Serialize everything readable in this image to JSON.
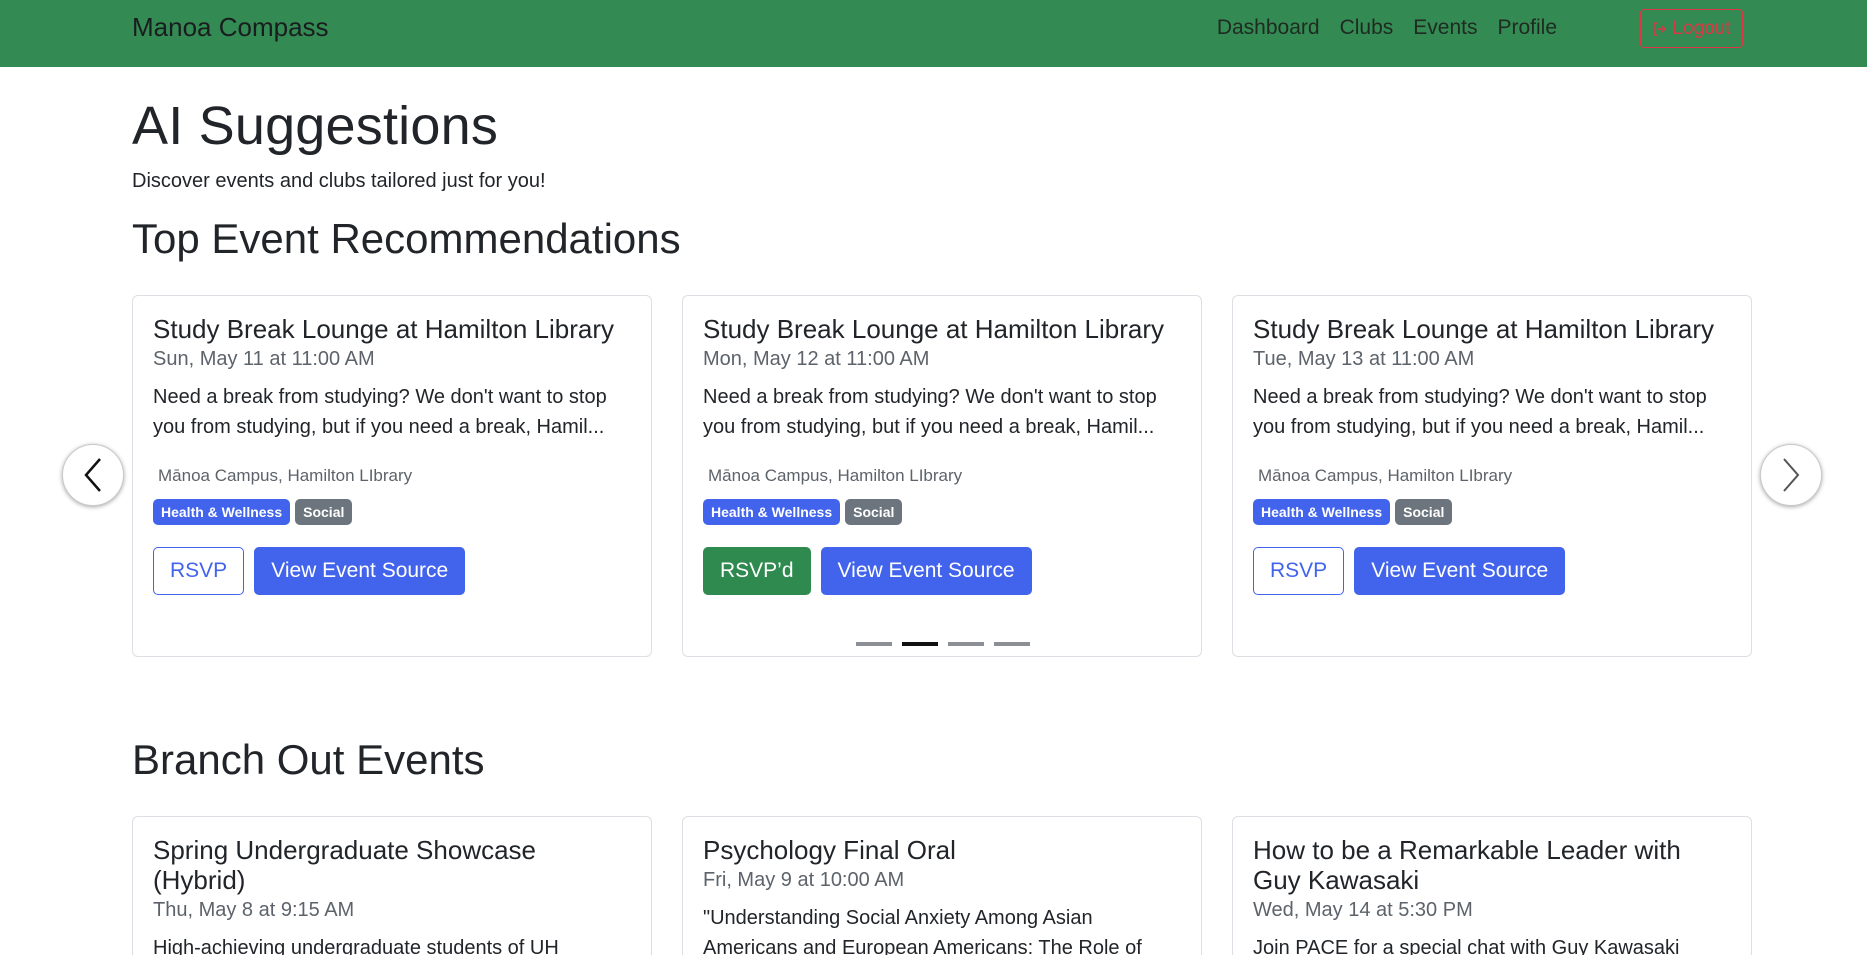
{
  "nav": {
    "brand": "Manoa Compass",
    "links": [
      "Dashboard",
      "Clubs",
      "Events",
      "Profile"
    ],
    "logout": "Logout"
  },
  "page": {
    "title": "AI Suggestions",
    "subtitle": "Discover events and clubs tailored just for you!"
  },
  "sections": {
    "top": "Top Event Recommendations",
    "branch": "Branch Out Events"
  },
  "top_events": [
    {
      "title": "Study Break Lounge at Hamilton Library",
      "date": "Sun, May 11 at 11:00 AM",
      "desc": "Need a break from studying? We don't want to stop you from studying, but if you need a break, Hamil...",
      "location": "Mānoa Campus, Hamilton LIbrary",
      "tags": [
        "Health & Wellness",
        "Social"
      ],
      "rsvp": "RSVP",
      "source": "View Event Source"
    },
    {
      "title": "Study Break Lounge at Hamilton Library",
      "date": "Mon, May 12 at 11:00 AM",
      "desc": "Need a break from studying? We don't want to stop you from studying, but if you need a break, Hamil...",
      "location": "Mānoa Campus, Hamilton LIbrary",
      "tags": [
        "Health & Wellness",
        "Social"
      ],
      "rsvp": "RSVP’d",
      "source": "View Event Source"
    },
    {
      "title": "Study Break Lounge at Hamilton Library",
      "date": "Tue, May 13 at 11:00 AM",
      "desc": "Need a break from studying? We don't want to stop you from studying, but if you need a break, Hamil...",
      "location": "Mānoa Campus, Hamilton LIbrary",
      "tags": [
        "Health & Wellness",
        "Social"
      ],
      "rsvp": "RSVP",
      "source": "View Event Source"
    }
  ],
  "branch_events": [
    {
      "title": "Spring Undergraduate Showcase (Hybrid)",
      "date": "Thu, May 8 at 9:15 AM",
      "desc": "High-achieving undergraduate students of UH"
    },
    {
      "title": "Psychology Final Oral",
      "date": "Fri, May 9 at 10:00 AM",
      "desc": "\"Understanding Social Anxiety Among Asian Americans and European Americans: The Role of"
    },
    {
      "title": "How to be a Remarkable Leader with Guy Kawasaki",
      "date": "Wed, May 14 at 5:30 PM",
      "desc": "Join PACE for a special chat with Guy Kawasaki"
    }
  ],
  "colors": {
    "navbar": "#338a52",
    "primary": "#4263eb",
    "success": "#2f8a4f",
    "secondary": "#6c757d",
    "danger": "#dc3545"
  }
}
